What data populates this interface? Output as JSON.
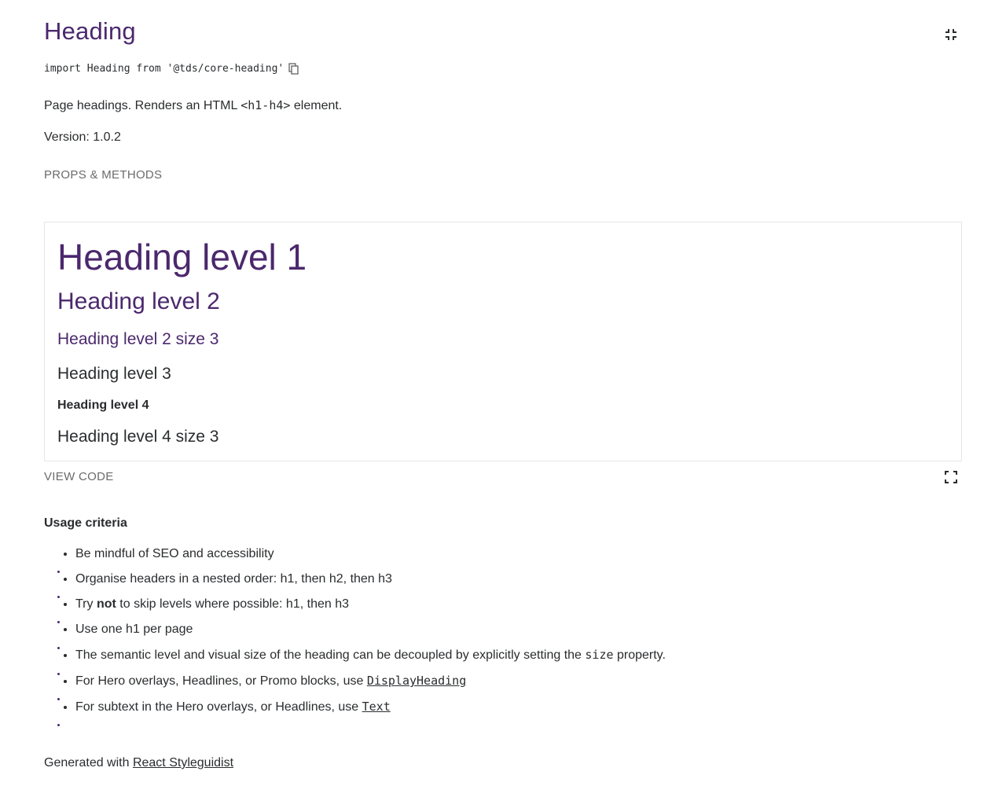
{
  "header": {
    "title": "Heading",
    "import_statement": "import Heading from '@tds/core-heading'",
    "description_pre": "Page headings. Renders an HTML ",
    "description_code": "<h1-h4>",
    "description_post": " element.",
    "version": "Version: 1.0.2",
    "props_link": "PROPS & METHODS"
  },
  "preview": {
    "h1": "Heading level 1",
    "h2": "Heading level 2",
    "h2_size3": "Heading level 2 size 3",
    "h3": "Heading level 3",
    "h4": "Heading level 4",
    "h4_size3": "Heading level 4 size 3"
  },
  "controls": {
    "view_code": "VIEW CODE"
  },
  "usage": {
    "title": "Usage criteria",
    "item1": "Be mindful of SEO and accessibility",
    "item2": "Organise headers in a nested order: h1, then h2, then h3",
    "item3_pre": "Try ",
    "item3_bold": "not",
    "item3_post": " to skip levels where possible: h1, then h3",
    "item4": "Use one h1 per page",
    "item5_pre": "The semantic level and visual size of the heading can be decoupled by explicitly setting the ",
    "item5_code": "size",
    "item5_post": " property.",
    "item6_pre": "For Hero overlays, Headlines, or Promo blocks, use ",
    "item6_link": "DisplayHeading",
    "item7_pre": "For subtext in the Hero overlays, or Headlines, use ",
    "item7_link": "Text"
  },
  "footer": {
    "prefix": "Generated with ",
    "link": "React Styleguidist"
  },
  "icons": {
    "collapse": "collapse-icon",
    "expand": "expand-icon",
    "copy": "copy-icon"
  },
  "colors": {
    "brand_purple": "#4b286d",
    "text": "#2a2c2e",
    "muted": "#6b6b6b",
    "border": "#e3e6e8"
  }
}
